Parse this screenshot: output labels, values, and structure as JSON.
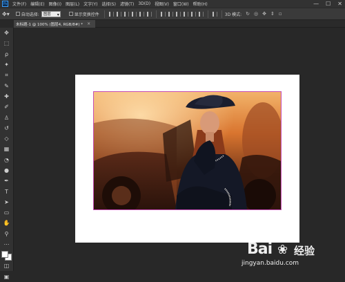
{
  "app": {
    "logo_text": "Ps"
  },
  "menus": [
    "文件(F)",
    "编辑(E)",
    "图像(I)",
    "图层(L)",
    "文字(Y)",
    "选择(S)",
    "滤镜(T)",
    "3D(D)",
    "视图(V)",
    "窗口(W)",
    "帮助(H)"
  ],
  "window_controls": {
    "minimize": "—",
    "maximize": "☐",
    "close": "✕"
  },
  "options_bar": {
    "auto_select_label": "自动选择:",
    "auto_select_value": "图层",
    "show_transform_label": "显示变换控件",
    "mode_3d_label": "3D 模式:"
  },
  "document_tab": {
    "title": "未标题-1 @ 100% (图层4, RGB/8#) *",
    "close": "×"
  },
  "tools": [
    {
      "name": "move-tool",
      "glyph": "✥"
    },
    {
      "name": "marquee-tool",
      "glyph": "⬚"
    },
    {
      "name": "lasso-tool",
      "glyph": "ρ"
    },
    {
      "name": "magic-wand-tool",
      "glyph": "✦"
    },
    {
      "name": "crop-tool",
      "glyph": "⌗"
    },
    {
      "name": "eyedropper-tool",
      "glyph": "✎"
    },
    {
      "name": "spot-healing-tool",
      "glyph": "✚"
    },
    {
      "name": "brush-tool",
      "glyph": "✐"
    },
    {
      "name": "clone-stamp-tool",
      "glyph": "♙"
    },
    {
      "name": "history-brush-tool",
      "glyph": "↺"
    },
    {
      "name": "eraser-tool",
      "glyph": "◇"
    },
    {
      "name": "gradient-tool",
      "glyph": "▦"
    },
    {
      "name": "blur-tool",
      "glyph": "◔"
    },
    {
      "name": "dodge-tool",
      "glyph": "●"
    },
    {
      "name": "pen-tool",
      "glyph": "✒"
    },
    {
      "name": "type-tool",
      "glyph": "T"
    },
    {
      "name": "path-selection-tool",
      "glyph": "➤"
    },
    {
      "name": "shape-tool",
      "glyph": "▭"
    },
    {
      "name": "hand-tool",
      "glyph": "✋"
    },
    {
      "name": "zoom-tool",
      "glyph": "⚲"
    },
    {
      "name": "edit-toolbar-tool",
      "glyph": "⋯"
    }
  ],
  "watermark": {
    "brand": "Bai",
    "paw": "❀",
    "jingyan": "经验",
    "url": "jingyan.baidu.com"
  },
  "colors": {
    "canvas_bg": "#282828",
    "document": "#ffffff",
    "selection_outline": "#c44bb4"
  }
}
